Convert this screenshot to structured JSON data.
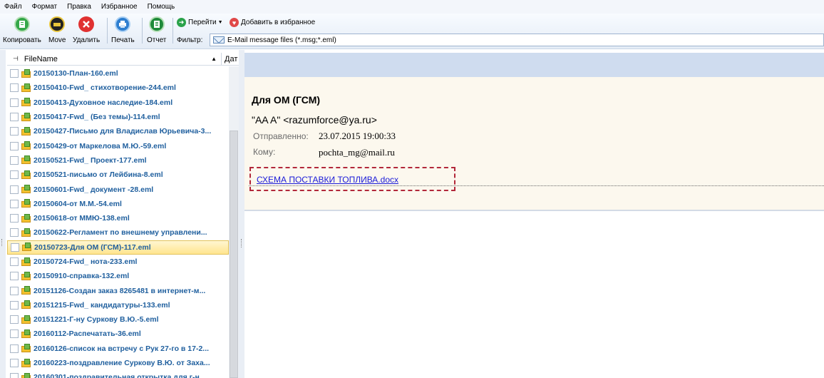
{
  "menubar": {
    "items": [
      "Файл",
      "Формат",
      "Правка",
      "Избранное",
      "Помощь"
    ]
  },
  "toolbar": {
    "copy_label": "Копировать",
    "move_label": "Move",
    "delete_label": "Удалить",
    "print_label": "Печать",
    "report_label": "Отчет",
    "goto_label": "Перейти",
    "favorites_label": "Добавить в избранное",
    "filter_label": "Фильтр:",
    "filter_value": "E-Mail message files (*.msg;*.eml)"
  },
  "filelist": {
    "column_filename": "FileName",
    "column_date": "Дат",
    "items": [
      "20150130-План-160.eml",
      "20150410-Fwd_ стихотворение-244.eml",
      "20150413-Духовное наследие-184.eml",
      "20150417-Fwd_ (Без темы)-114.eml",
      "20150427-Письмо для Владислав Юрьевича-3...",
      "20150429-от Маркелова М.Ю.-59.eml",
      "20150521-Fwd_ Проект-177.eml",
      "20150521-письмо от Лейбина-8.eml",
      "20150601-Fwd_ документ -28.eml",
      "20150604-от М.М.-54.eml",
      "20150618-от ММЮ-138.eml",
      "20150622-Регламент по внешнему управлени...",
      "20150723-Для ОМ (ГСМ)-117.eml",
      "20150724-Fwd_ нота-233.eml",
      "20150910-справка-132.eml",
      "20151126-Создан заказ 8265481 в интернет-м...",
      "20151215-Fwd_ кандидатуры-133.eml",
      "20151221-Г-ну Суркову В.Ю.-5.eml",
      "20160112-Распечатать-36.eml",
      "20160126-список на встречу с Рук 27-го в 17-2...",
      "20160223-поздравление Суркову В.Ю. от Заха...",
      "20160301-поздравительная открытка для г-н..."
    ],
    "selected_index": 12
  },
  "message": {
    "subject": "Для ОМ (ГСМ)",
    "from": "\"AA A\" <razumforce@ya.ru>",
    "sent_label": "Отправленно:",
    "sent_value": "23.07.2015 19:00:33",
    "to_label": "Кому:",
    "to_value": "pochta_mg@mail.ru",
    "attachment": "СХЕМА ПОСТАВКИ ТОПЛИВА.docx"
  },
  "colors": {
    "accent_blue": "#1f5f9e",
    "header_bg": "#fcf8ee",
    "highlight_border": "#b2283a",
    "selected_row": "#ffe58e"
  }
}
